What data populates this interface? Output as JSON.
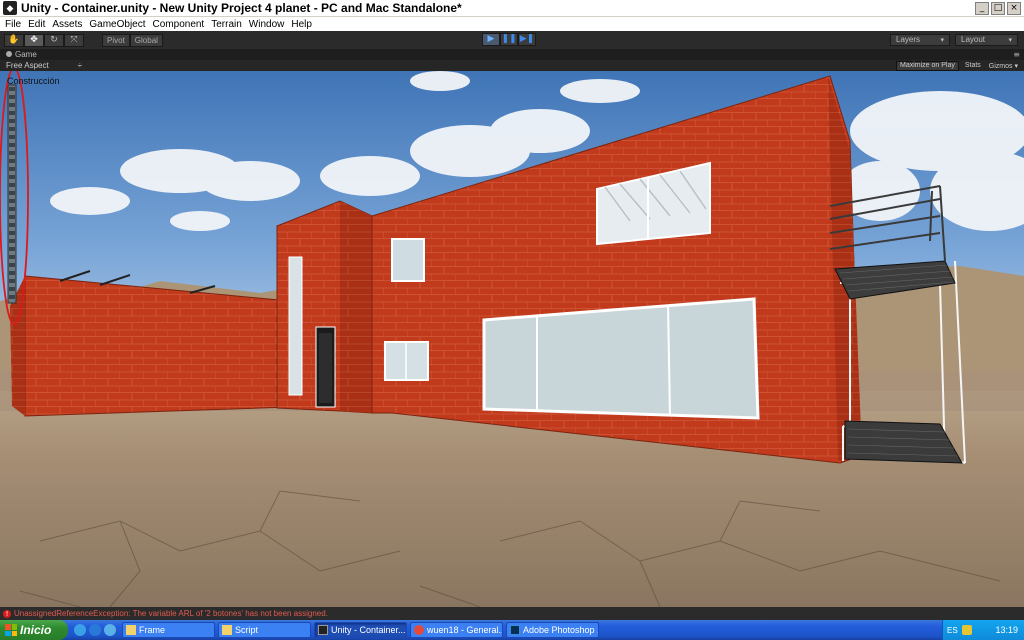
{
  "window": {
    "title": "Unity - Container.unity - New Unity Project 4 planet - PC and Mac Standalone*",
    "app_icon": "unity-icon",
    "buttons": {
      "minimize": "_",
      "maximize": "□",
      "close": "×"
    }
  },
  "menubar": {
    "items": [
      "File",
      "Edit",
      "Assets",
      "GameObject",
      "Component",
      "Terrain",
      "Window",
      "Help"
    ]
  },
  "toolbar": {
    "transform_tools": [
      {
        "icon": "hand-icon",
        "glyph": "✋"
      },
      {
        "icon": "move-icon",
        "glyph": "✥"
      },
      {
        "icon": "rotate-icon",
        "glyph": "↻"
      },
      {
        "icon": "scale-icon",
        "glyph": "⤧"
      }
    ],
    "pivot_label": "Pivot",
    "global_label": "Global",
    "play": {
      "glyph": "▶"
    },
    "pause": {
      "glyph": "❚❚"
    },
    "step": {
      "glyph": "▶❚"
    },
    "layers_label": "Layers",
    "layout_label": "Layout",
    "dropdown_arrow": "▾"
  },
  "game_panel": {
    "tab_label": "Game",
    "menu_glyph": "≡",
    "aspect_label": "Free Aspect",
    "aspect_arrow": "÷",
    "maximize_on_play": "Maximize on Play",
    "stats": "Stats",
    "gizmos": "Gizmos",
    "gizmos_arrow": "▾"
  },
  "game_view": {
    "gui_label": "Construcción"
  },
  "status_bar": {
    "icon": "error-icon",
    "glyph": "!",
    "message": "UnassignedReferenceException: The variable ARL of '2 botones' has not been assigned."
  },
  "taskbar": {
    "start_label": "Inicio",
    "quick_launch": [
      {
        "icon": "chrome-icon",
        "color": "#3aa1e8"
      },
      {
        "icon": "ie-icon",
        "color": "#2a79d8"
      },
      {
        "icon": "desktop-icon",
        "color": "#5ab1e8"
      }
    ],
    "tasks": [
      {
        "label": "Frame",
        "icon": "folder-icon",
        "active": false
      },
      {
        "label": "Script",
        "icon": "folder-icon",
        "active": false
      },
      {
        "label": "Unity - Container....",
        "icon": "unity-icon",
        "active": true
      },
      {
        "label": "wuen18 - General...",
        "icon": "chrome-icon",
        "active": false
      },
      {
        "label": "Adobe Photoshop ...",
        "icon": "photoshop-icon",
        "active": false
      }
    ],
    "tray_lang": "ES",
    "clock": "13:19"
  }
}
